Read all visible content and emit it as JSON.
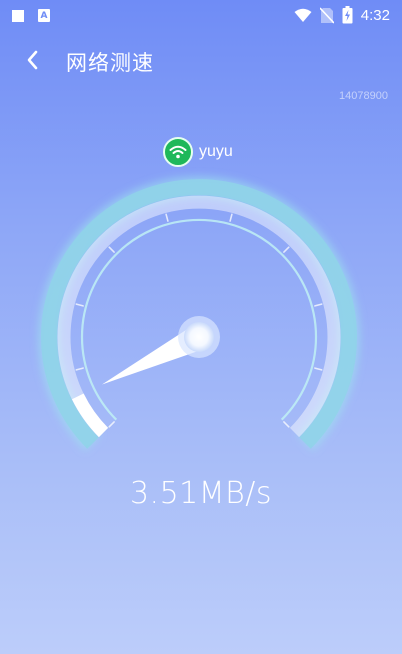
{
  "status_bar": {
    "time": "4:32",
    "icons": [
      "stop-square-icon",
      "a-notification-icon",
      "wifi-signal-icon",
      "no-sim-icon",
      "battery-charging-icon"
    ]
  },
  "header": {
    "title": "网络测速",
    "back_icon": "chevron-left-icon",
    "code": "14078900"
  },
  "network": {
    "name": "yuyu",
    "icon": "wifi-icon"
  },
  "gauge": {
    "progress": 0.07,
    "speed_text": "3.51MB/s",
    "colors": {
      "track": "#8fd3e8",
      "fill": "#ffffff",
      "needle": "#ffffff",
      "wifi_badge": "#1fb85a"
    }
  }
}
